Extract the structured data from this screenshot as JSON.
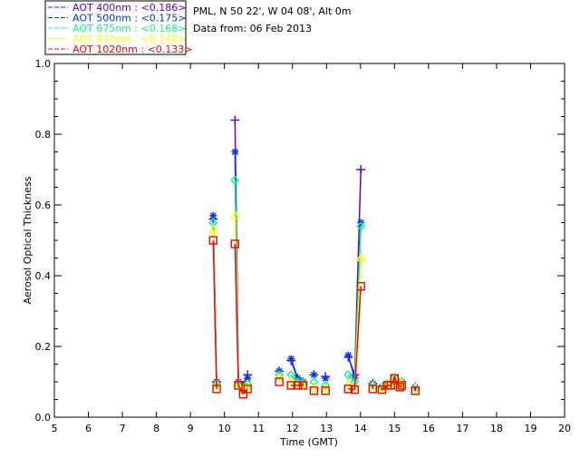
{
  "chart_data": {
    "type": "line",
    "header": [
      "PML, N 50 22', W 04 08', Alt 0m",
      "Data from: 06 Feb 2013"
    ],
    "xlabel": "Time (GMT)",
    "ylabel": "Aerosol Optical Thickness",
    "xlim": [
      5,
      20
    ],
    "ylim": [
      0,
      1.0
    ],
    "xticks": [
      5,
      6,
      7,
      8,
      9,
      10,
      11,
      12,
      13,
      14,
      15,
      16,
      17,
      18,
      19,
      20
    ],
    "yticks": [
      "0.0",
      "0.2",
      "0.4",
      "0.6",
      "0.8",
      "1.0"
    ],
    "grid": false,
    "legend_placement": "top-left, outside plot",
    "x": [
      9.67,
      9.77,
      10.31,
      10.41,
      10.55,
      10.68,
      11.61,
      11.96,
      12.15,
      12.31,
      12.63,
      12.97,
      13.64,
      13.83,
      14.01,
      14.36,
      14.63,
      14.79,
      14.89,
      15.0,
      15.16,
      15.21,
      15.61
    ],
    "series": [
      {
        "name": "AOT  400nm : <0.186>",
        "color": "#6600cc",
        "marker": "plus",
        "values": [
          0.56,
          0.1,
          0.84,
          0.1,
          0.09,
          0.12,
          0.13,
          0.16,
          0.11,
          0.1,
          0.12,
          0.115,
          0.17,
          0.12,
          0.7,
          0.095,
          0.085,
          0.095,
          0.095,
          0.11,
          0.095,
          0.1,
          0.085
        ]
      },
      {
        "name": "AOT  500nm : <0.175>",
        "color": "#0033ff",
        "marker": "asterisk",
        "values": [
          0.57,
          0.1,
          0.75,
          0.1,
          0.09,
          0.11,
          0.13,
          0.165,
          0.11,
          0.1,
          0.12,
          0.11,
          0.175,
          0.11,
          0.55,
          0.095,
          0.085,
          0.095,
          0.095,
          0.11,
          0.095,
          0.1,
          0.085
        ]
      },
      {
        "name": "AOT  675nm : <0.168>",
        "color": "#00ff88",
        "marker": "diamond",
        "values": [
          0.55,
          0.095,
          0.67,
          0.095,
          0.08,
          0.095,
          0.12,
          0.12,
          0.1,
          0.1,
          0.1,
          0.09,
          0.12,
          0.1,
          0.54,
          0.09,
          0.085,
          0.095,
          0.095,
          0.11,
          0.095,
          0.1,
          0.08
        ]
      },
      {
        "name": "AOT  870nm : <0.148>",
        "color": "#ffff00",
        "marker": "triangle",
        "values": [
          0.53,
          0.09,
          0.57,
          0.09,
          0.075,
          0.09,
          0.11,
          0.1,
          0.09,
          0.09,
          0.08,
          0.08,
          0.09,
          0.085,
          0.45,
          0.085,
          0.08,
          0.09,
          0.09,
          0.11,
          0.09,
          0.095,
          0.08
        ]
      },
      {
        "name": "AOT 1020nm : <0.133>",
        "color": "#ff0000",
        "marker": "square",
        "values": [
          0.5,
          0.08,
          0.49,
          0.09,
          0.065,
          0.08,
          0.1,
          0.09,
          0.09,
          0.09,
          0.075,
          0.075,
          0.08,
          0.078,
          0.37,
          0.08,
          0.078,
          0.09,
          0.09,
          0.11,
          0.085,
          0.09,
          0.075
        ]
      }
    ]
  }
}
